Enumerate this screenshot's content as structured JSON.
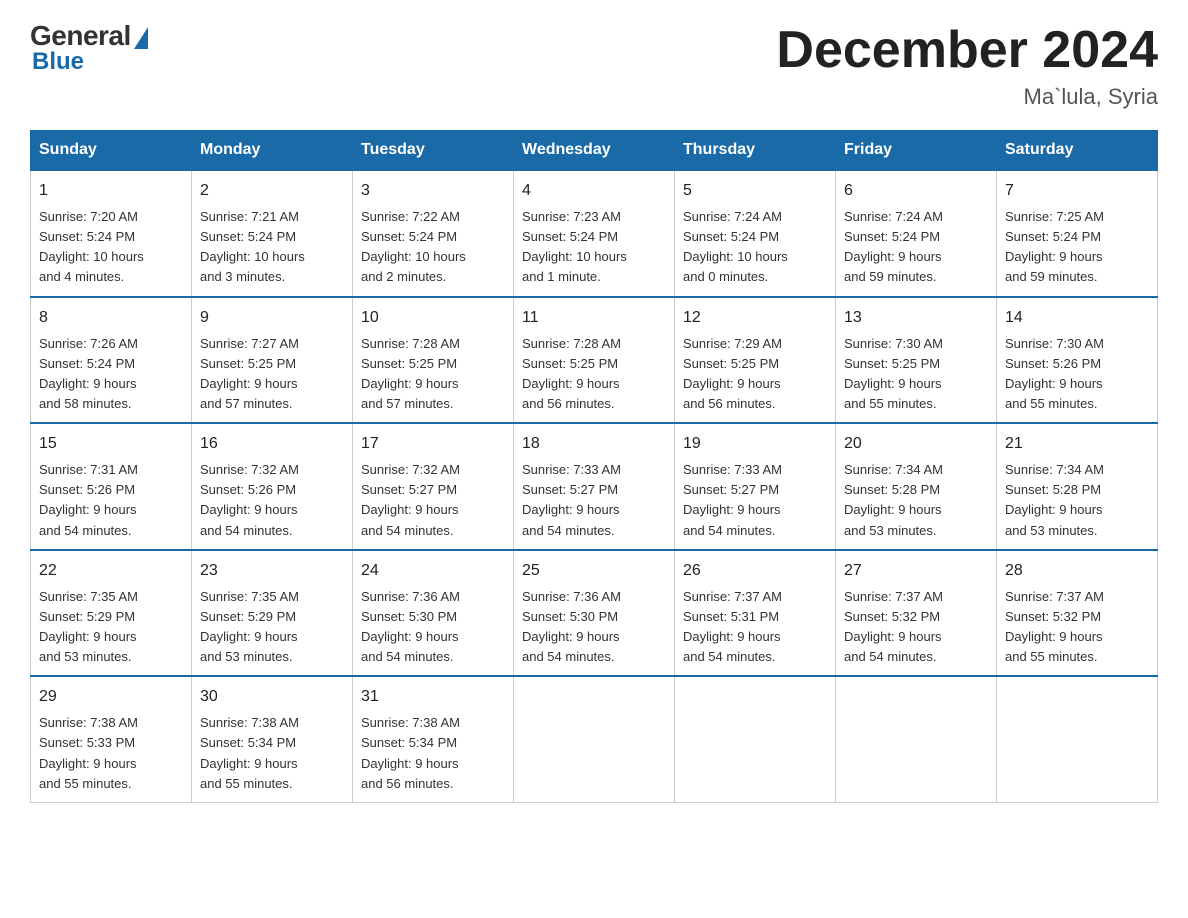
{
  "logo": {
    "general": "General",
    "blue": "Blue"
  },
  "header": {
    "month": "December 2024",
    "location": "Ma`lula, Syria"
  },
  "days_of_week": [
    "Sunday",
    "Monday",
    "Tuesday",
    "Wednesday",
    "Thursday",
    "Friday",
    "Saturday"
  ],
  "weeks": [
    [
      {
        "day": "1",
        "sunrise": "7:20 AM",
        "sunset": "5:24 PM",
        "daylight": "10 hours and 4 minutes."
      },
      {
        "day": "2",
        "sunrise": "7:21 AM",
        "sunset": "5:24 PM",
        "daylight": "10 hours and 3 minutes."
      },
      {
        "day": "3",
        "sunrise": "7:22 AM",
        "sunset": "5:24 PM",
        "daylight": "10 hours and 2 minutes."
      },
      {
        "day": "4",
        "sunrise": "7:23 AM",
        "sunset": "5:24 PM",
        "daylight": "10 hours and 1 minute."
      },
      {
        "day": "5",
        "sunrise": "7:24 AM",
        "sunset": "5:24 PM",
        "daylight": "10 hours and 0 minutes."
      },
      {
        "day": "6",
        "sunrise": "7:24 AM",
        "sunset": "5:24 PM",
        "daylight": "9 hours and 59 minutes."
      },
      {
        "day": "7",
        "sunrise": "7:25 AM",
        "sunset": "5:24 PM",
        "daylight": "9 hours and 59 minutes."
      }
    ],
    [
      {
        "day": "8",
        "sunrise": "7:26 AM",
        "sunset": "5:24 PM",
        "daylight": "9 hours and 58 minutes."
      },
      {
        "day": "9",
        "sunrise": "7:27 AM",
        "sunset": "5:25 PM",
        "daylight": "9 hours and 57 minutes."
      },
      {
        "day": "10",
        "sunrise": "7:28 AM",
        "sunset": "5:25 PM",
        "daylight": "9 hours and 57 minutes."
      },
      {
        "day": "11",
        "sunrise": "7:28 AM",
        "sunset": "5:25 PM",
        "daylight": "9 hours and 56 minutes."
      },
      {
        "day": "12",
        "sunrise": "7:29 AM",
        "sunset": "5:25 PM",
        "daylight": "9 hours and 56 minutes."
      },
      {
        "day": "13",
        "sunrise": "7:30 AM",
        "sunset": "5:25 PM",
        "daylight": "9 hours and 55 minutes."
      },
      {
        "day": "14",
        "sunrise": "7:30 AM",
        "sunset": "5:26 PM",
        "daylight": "9 hours and 55 minutes."
      }
    ],
    [
      {
        "day": "15",
        "sunrise": "7:31 AM",
        "sunset": "5:26 PM",
        "daylight": "9 hours and 54 minutes."
      },
      {
        "day": "16",
        "sunrise": "7:32 AM",
        "sunset": "5:26 PM",
        "daylight": "9 hours and 54 minutes."
      },
      {
        "day": "17",
        "sunrise": "7:32 AM",
        "sunset": "5:27 PM",
        "daylight": "9 hours and 54 minutes."
      },
      {
        "day": "18",
        "sunrise": "7:33 AM",
        "sunset": "5:27 PM",
        "daylight": "9 hours and 54 minutes."
      },
      {
        "day": "19",
        "sunrise": "7:33 AM",
        "sunset": "5:27 PM",
        "daylight": "9 hours and 54 minutes."
      },
      {
        "day": "20",
        "sunrise": "7:34 AM",
        "sunset": "5:28 PM",
        "daylight": "9 hours and 53 minutes."
      },
      {
        "day": "21",
        "sunrise": "7:34 AM",
        "sunset": "5:28 PM",
        "daylight": "9 hours and 53 minutes."
      }
    ],
    [
      {
        "day": "22",
        "sunrise": "7:35 AM",
        "sunset": "5:29 PM",
        "daylight": "9 hours and 53 minutes."
      },
      {
        "day": "23",
        "sunrise": "7:35 AM",
        "sunset": "5:29 PM",
        "daylight": "9 hours and 53 minutes."
      },
      {
        "day": "24",
        "sunrise": "7:36 AM",
        "sunset": "5:30 PM",
        "daylight": "9 hours and 54 minutes."
      },
      {
        "day": "25",
        "sunrise": "7:36 AM",
        "sunset": "5:30 PM",
        "daylight": "9 hours and 54 minutes."
      },
      {
        "day": "26",
        "sunrise": "7:37 AM",
        "sunset": "5:31 PM",
        "daylight": "9 hours and 54 minutes."
      },
      {
        "day": "27",
        "sunrise": "7:37 AM",
        "sunset": "5:32 PM",
        "daylight": "9 hours and 54 minutes."
      },
      {
        "day": "28",
        "sunrise": "7:37 AM",
        "sunset": "5:32 PM",
        "daylight": "9 hours and 55 minutes."
      }
    ],
    [
      {
        "day": "29",
        "sunrise": "7:38 AM",
        "sunset": "5:33 PM",
        "daylight": "9 hours and 55 minutes."
      },
      {
        "day": "30",
        "sunrise": "7:38 AM",
        "sunset": "5:34 PM",
        "daylight": "9 hours and 55 minutes."
      },
      {
        "day": "31",
        "sunrise": "7:38 AM",
        "sunset": "5:34 PM",
        "daylight": "9 hours and 56 minutes."
      },
      null,
      null,
      null,
      null
    ]
  ],
  "labels": {
    "sunrise": "Sunrise:",
    "sunset": "Sunset:",
    "daylight": "Daylight:"
  }
}
